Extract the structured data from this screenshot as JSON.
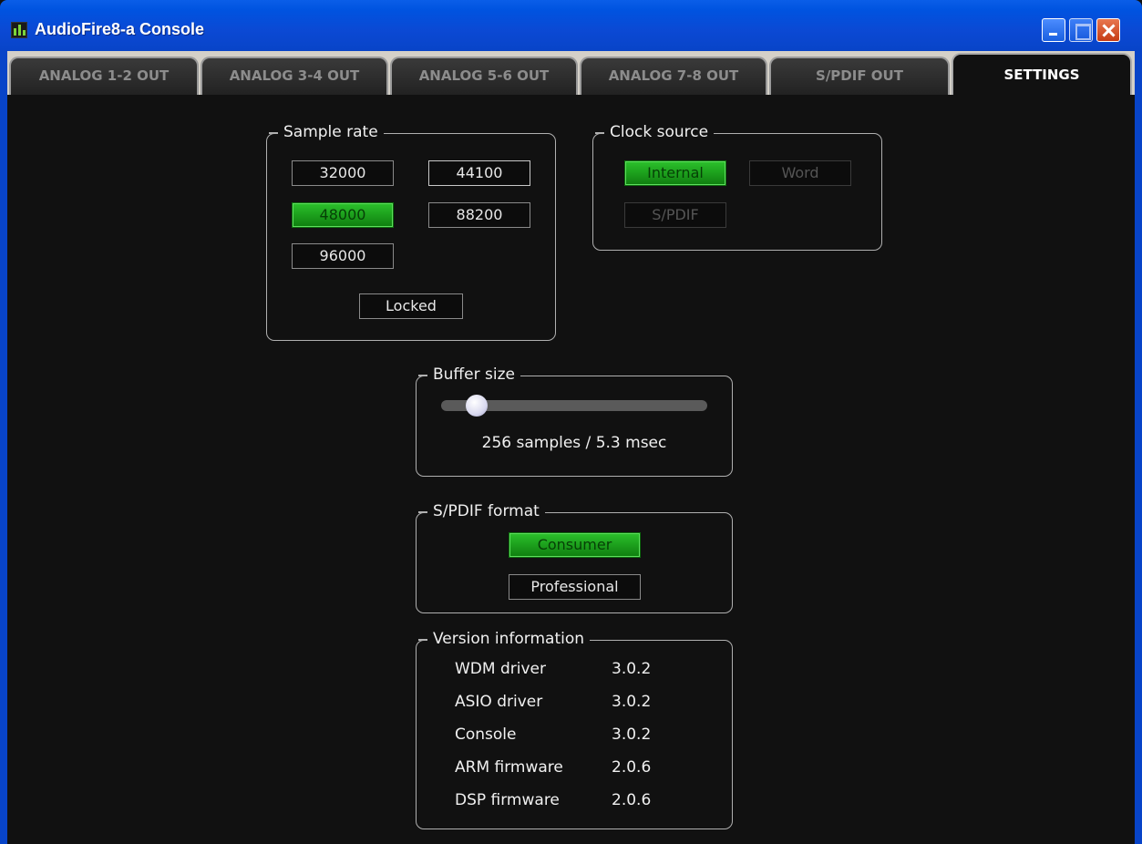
{
  "window": {
    "title": "AudioFire8-a Console"
  },
  "tabs": [
    {
      "label": "ANALOG 1-2 OUT"
    },
    {
      "label": "ANALOG 3-4 OUT"
    },
    {
      "label": "ANALOG 5-6 OUT"
    },
    {
      "label": "ANALOG 7-8 OUT"
    },
    {
      "label": "S/PDIF OUT"
    },
    {
      "label": "SETTINGS",
      "active": true
    }
  ],
  "sample_rate": {
    "title": "Sample rate",
    "options": [
      "32000",
      "44100",
      "48000",
      "88200",
      "96000"
    ],
    "selected": "48000",
    "lock_status": "Locked"
  },
  "clock_source": {
    "title": "Clock source",
    "options": [
      "Internal",
      "Word",
      "S/PDIF"
    ],
    "selected": "Internal"
  },
  "buffer_size": {
    "title": "Buffer size",
    "value_text": "256 samples / 5.3 msec",
    "slider_fraction": 0.1
  },
  "spdif_format": {
    "title": "S/PDIF format",
    "options": [
      "Consumer",
      "Professional"
    ],
    "selected": "Consumer"
  },
  "version_info": {
    "title": "Version information",
    "rows": [
      {
        "label": "WDM driver",
        "value": "3.0.2"
      },
      {
        "label": "ASIO driver",
        "value": "3.0.2"
      },
      {
        "label": "Console",
        "value": "3.0.2"
      },
      {
        "label": "ARM firmware",
        "value": "2.0.6"
      },
      {
        "label": "DSP firmware",
        "value": "2.0.6"
      }
    ]
  },
  "colors": {
    "accent_green": "#1ea31e",
    "titlebar_blue": "#0a5ee8",
    "background": "#111111"
  }
}
